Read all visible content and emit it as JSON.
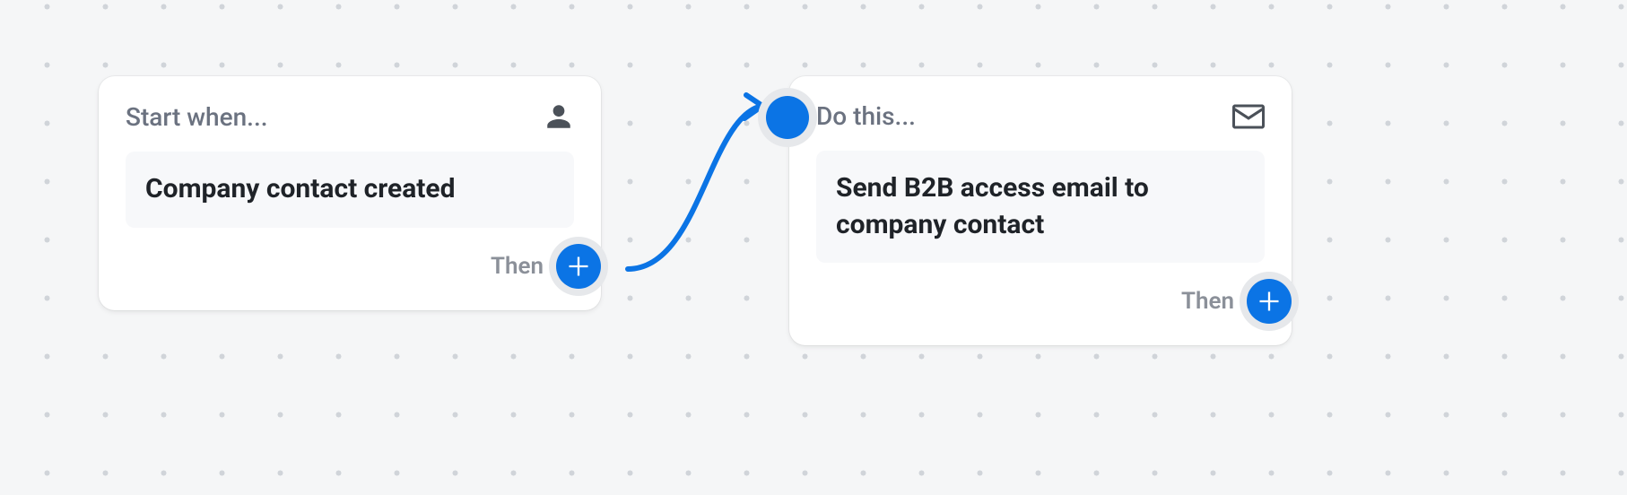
{
  "colors": {
    "accent": "#0b74e5",
    "bg": "#f5f6f7",
    "card_bg": "#ffffff",
    "muted": "#6b7280"
  },
  "trigger": {
    "header_label": "Start when...",
    "icon": "person-icon",
    "body": "Company contact created",
    "then_label": "Then"
  },
  "action": {
    "header_label": "Do this...",
    "icon": "mail-icon",
    "body": "Send B2B access email to company contact",
    "then_label": "Then"
  }
}
